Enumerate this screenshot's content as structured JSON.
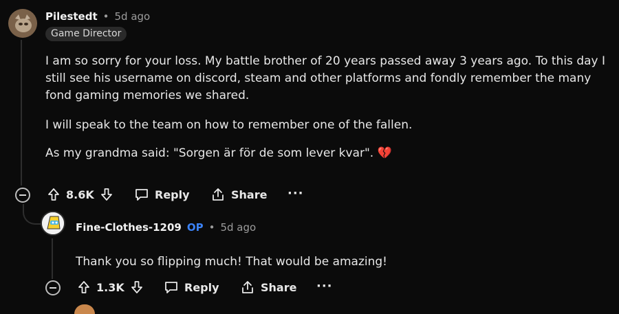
{
  "comment1": {
    "username": "Pilestedt",
    "separator": "•",
    "time_ago": "5d ago",
    "flair": "Game Director",
    "paragraphs": [
      "I am so sorry for your loss. My battle brother of 20 years passed away 3 years ago. To this day I",
      "still see his username on discord, steam and other platforms and fondly remember the many",
      "fond gaming memories we shared.",
      "I will speak to the team on how to remember one of the fallen.",
      "As my grandma said: \"Sorgen är för de som lever kvar\". 💔"
    ],
    "actions": {
      "upvotes": "8.6K",
      "reply": "Reply",
      "share": "Share",
      "more": "···"
    }
  },
  "comment2": {
    "username": "Fine-Clothes-1209",
    "op_badge": "OP",
    "separator": "•",
    "time_ago": "5d ago",
    "text": "Thank you so flipping much! That would be amazing!",
    "actions": {
      "upvotes": "1.3K",
      "reply": "Reply",
      "share": "Share",
      "more": "···"
    }
  },
  "icons": {
    "upvote": "arrow-up-icon",
    "downvote": "arrow-down-icon",
    "reply": "speech-bubble-icon",
    "share": "share-icon",
    "collapse": "minus-circle-icon"
  },
  "colors": {
    "background": "#0b0b0b",
    "text": "#e8e8e8",
    "muted": "#9c9c9c",
    "op": "#3b82f6",
    "heart": "#e23e57"
  }
}
